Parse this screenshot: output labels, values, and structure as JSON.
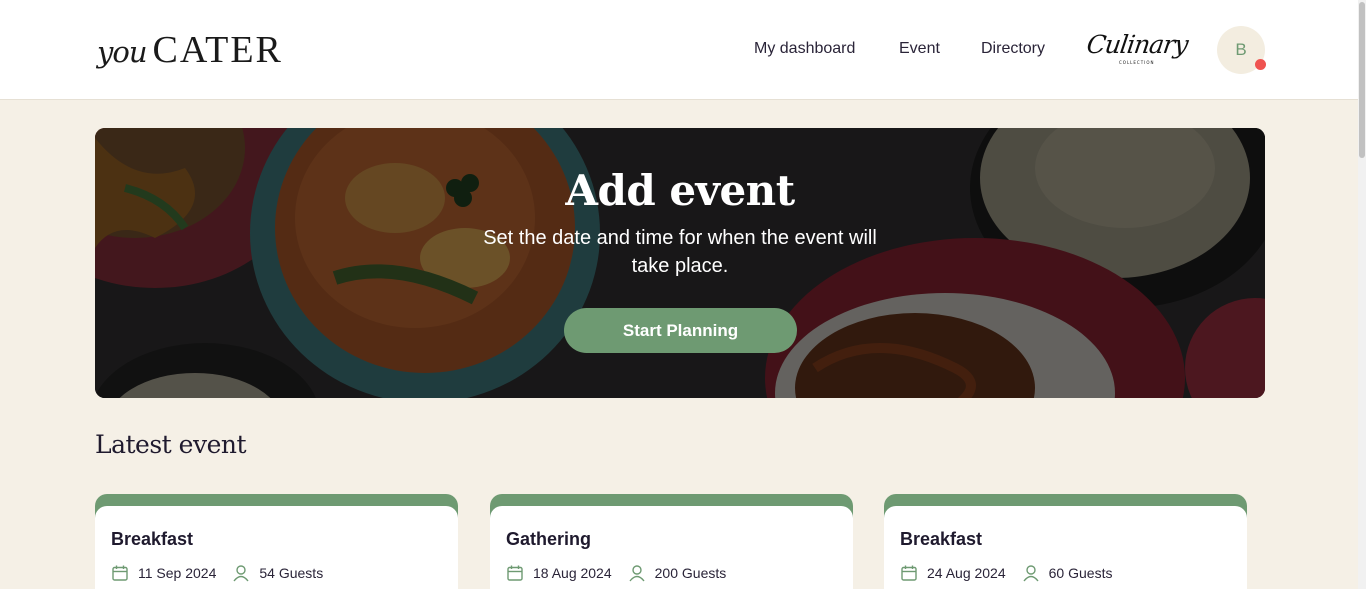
{
  "header": {
    "logo_you": "you",
    "logo_cater": "CATER",
    "nav": [
      {
        "label": "My dashboard"
      },
      {
        "label": "Event"
      },
      {
        "label": "Directory"
      }
    ],
    "culinary_logo": "Culinary",
    "culinary_sub": "COLLECTION",
    "avatar_initial": "B"
  },
  "hero": {
    "title": "Add event",
    "subtitle": "Set the date and time for when the event will take place.",
    "button_label": "Start Planning"
  },
  "latest": {
    "title": "Latest event",
    "events": [
      {
        "title": "Breakfast",
        "date": "11 Sep 2024",
        "guests": "54 Guests"
      },
      {
        "title": "Gathering",
        "date": "18 Aug 2024",
        "guests": "200 Guests"
      },
      {
        "title": "Breakfast",
        "date": "24 Aug 2024",
        "guests": "60 Guests"
      }
    ]
  },
  "colors": {
    "accent": "#6e9a72",
    "background": "#f5f0e6",
    "notification": "#ef5350"
  },
  "icons": {
    "calendar": "calendar-icon",
    "user": "user-icon"
  }
}
